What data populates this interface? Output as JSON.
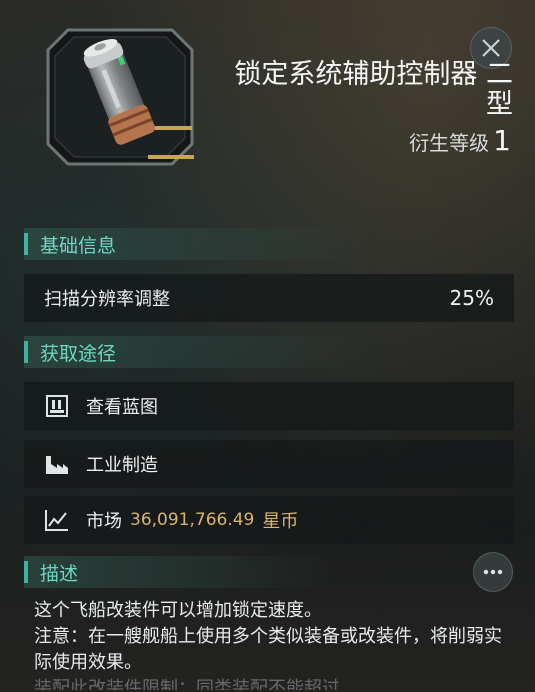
{
  "item": {
    "name": "锁定系统辅助控制器 二型",
    "level_label": "衍生等级",
    "level_value": "1",
    "icon": "capacitor-module-icon"
  },
  "sections": {
    "basic_info": "基础信息",
    "acquire": "获取途径",
    "description": "描述"
  },
  "stats": [
    {
      "label": "扫描分辨率调整",
      "value": "25%"
    }
  ],
  "sources": [
    {
      "icon": "blueprint-icon",
      "label": "查看蓝图"
    },
    {
      "icon": "factory-icon",
      "label": "工业制造"
    },
    {
      "icon": "market-chart-icon",
      "label": "市场",
      "price": "36,091,766.49",
      "unit": "星币"
    }
  ],
  "description": {
    "line1": "这个飞船改装件可以增加锁定速度。",
    "line2": "注意：在一艘舰船上使用多个类似装备或改装件，将削弱实际使用效果。",
    "line3": "装配此改装件限制：同类装配不能超过"
  },
  "colors": {
    "accent": "#3fb3a0",
    "section_text": "#6fd6c2",
    "price": "#d9b46a"
  }
}
